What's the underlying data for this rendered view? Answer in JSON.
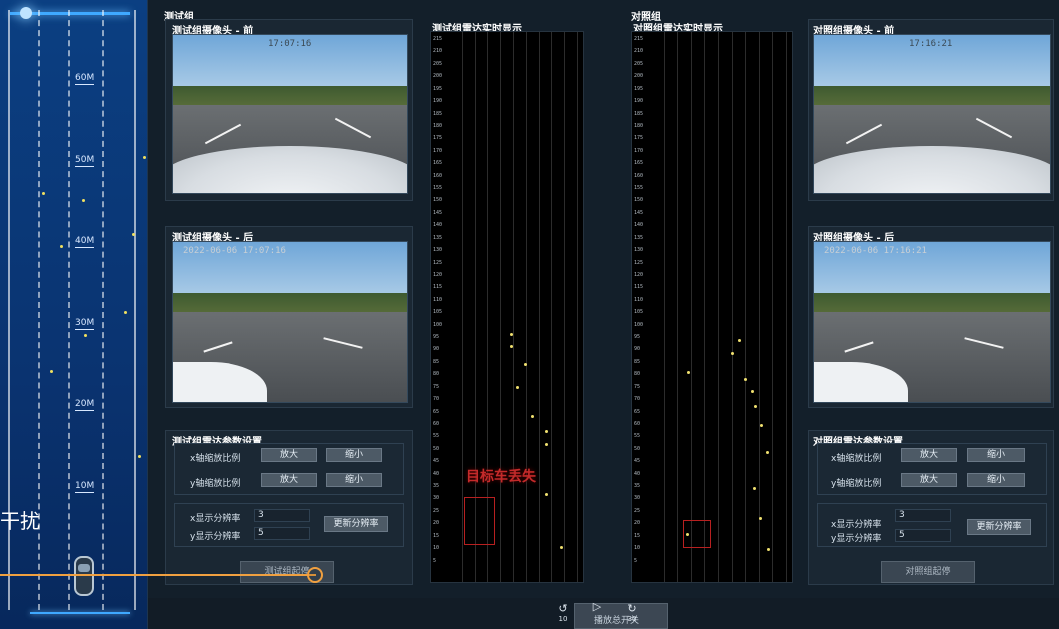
{
  "lane": {
    "distances": [
      "60M",
      "50M",
      "40M",
      "30M",
      "20M",
      "10M"
    ],
    "caption": "干扰"
  },
  "test_group": {
    "label": "测试组",
    "front_title": "测试组摄像头 - 前",
    "front_stamp": "17:07:16",
    "rear_title": "测试组摄像头 - 后",
    "rear_stamp": "2022-06-06 17:07:16",
    "radar_title": "测试组雷达实时显示",
    "params_title": "测试组雷达参数设置",
    "x_zoom_label": "x轴缩放比例",
    "y_zoom_label": "y轴缩放比例",
    "zoom_in": "放大",
    "zoom_out": "缩小",
    "x_res_label": "x显示分辨率",
    "y_res_label": "y显示分辨率",
    "x_res_value": "3",
    "y_res_value": "5",
    "update_res": "更新分辨率",
    "start_stop": "测试组起停"
  },
  "control_group": {
    "label": "对照组",
    "front_title": "对照组摄像头 - 前",
    "front_stamp": "17:16:21",
    "rear_title": "对照组摄像头 - 后",
    "rear_stamp": "2022-06-06 17:16:21",
    "radar_title": "对照组雷达实时显示",
    "params_title": "对照组雷达参数设置",
    "x_zoom_label": "x轴缩放比例",
    "y_zoom_label": "y轴缩放比例",
    "zoom_in": "放大",
    "zoom_out": "缩小",
    "x_res_label": "x显示分辨率",
    "y_res_label": "y显示分辨率",
    "x_res_value": "3",
    "y_res_value": "5",
    "update_res": "更新分辨率",
    "start_stop": "对照组起停"
  },
  "radar_ticks": [
    "215",
    "210",
    "205",
    "200",
    "195",
    "190",
    "185",
    "180",
    "175",
    "170",
    "165",
    "160",
    "155",
    "150",
    "145",
    "140",
    "135",
    "130",
    "125",
    "120",
    "115",
    "110",
    "105",
    "100",
    "95",
    "90",
    "85",
    "80",
    "75",
    "70",
    "65",
    "60",
    "55",
    "50",
    "45",
    "40",
    "35",
    "30",
    "25",
    "20",
    "15",
    "10",
    "5"
  ],
  "lost_target_text": "目标车丢失",
  "playback": {
    "back_10": "10",
    "forward_30": "30",
    "main_label": "播放总开关"
  },
  "colors": {
    "accent": "#f0a040",
    "radar_point": "#f0e070",
    "lost": "#c42a2a"
  }
}
